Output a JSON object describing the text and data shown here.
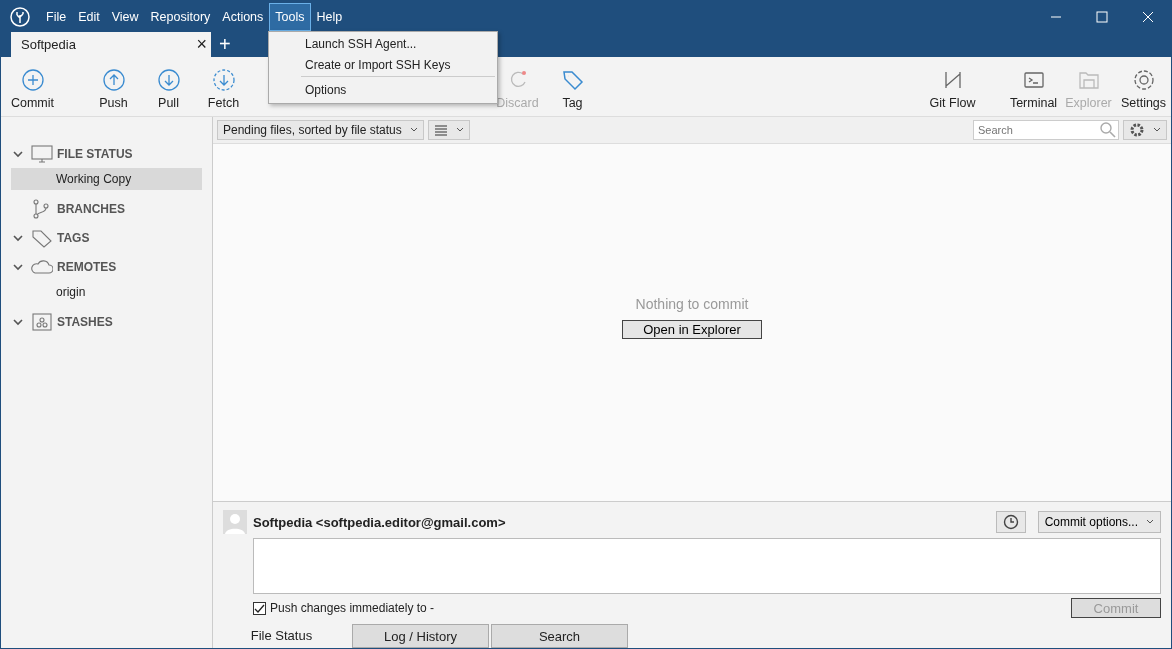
{
  "menu_bar": [
    {
      "label": "File",
      "selected": false
    },
    {
      "label": "Edit",
      "selected": false
    },
    {
      "label": "View",
      "selected": false
    },
    {
      "label": "Repository",
      "selected": false
    },
    {
      "label": "Actions",
      "selected": false
    },
    {
      "label": "Tools",
      "selected": true
    },
    {
      "label": "Help",
      "selected": false
    }
  ],
  "tabs": [
    {
      "label": "Softpedia",
      "selected": true,
      "close": "×"
    }
  ],
  "new_tab": "+",
  "tools_menu": [
    {
      "label": "Launch SSH Agent...",
      "separator_after": false
    },
    {
      "label": "Create or Import SSH Keys",
      "separator_after": true
    },
    {
      "label": "Options",
      "separator_after": false
    }
  ],
  "toolbar_left": [
    {
      "label": "Commit",
      "disabled": false
    },
    {
      "label": "Push",
      "disabled": false
    },
    {
      "label": "Pull",
      "disabled": false
    },
    {
      "label": "Fetch",
      "disabled": false
    },
    {
      "label": "Discard",
      "disabled": true
    },
    {
      "label": "Tag",
      "disabled": false
    }
  ],
  "toolbar_right": [
    {
      "label": "Git Flow",
      "disabled": false
    },
    {
      "label": "Terminal",
      "disabled": false
    },
    {
      "label": "Explorer",
      "disabled": true
    },
    {
      "label": "Settings",
      "disabled": false
    }
  ],
  "sidebar": {
    "sections": [
      {
        "label": "FILE STATUS",
        "expanded": true,
        "children": [
          {
            "label": "Working Copy",
            "selected": true
          }
        ]
      },
      {
        "label": "BRANCHES"
      },
      {
        "label": "TAGS",
        "expanded": true
      },
      {
        "label": "REMOTES",
        "expanded": true,
        "children": [
          {
            "label": "origin",
            "selected": false
          }
        ]
      },
      {
        "label": "STASHES",
        "expanded": true
      }
    ]
  },
  "filter": {
    "sort_dropdown": "Pending files, sorted by file status",
    "search_placeholder": "Search"
  },
  "empty_state": {
    "message": "Nothing to commit",
    "button": "Open in Explorer"
  },
  "commit": {
    "author": "Softpedia <softpedia.editor@gmail.com>",
    "options": "Commit options...",
    "push_label": "Push changes immediately to -",
    "push_checked": true,
    "commit_button": "Commit",
    "commit_disabled": true
  },
  "bottom_tabs": [
    {
      "label": "File Status",
      "selected": true
    },
    {
      "label": "Log / History",
      "selected": false
    },
    {
      "label": "Search",
      "selected": false
    }
  ]
}
